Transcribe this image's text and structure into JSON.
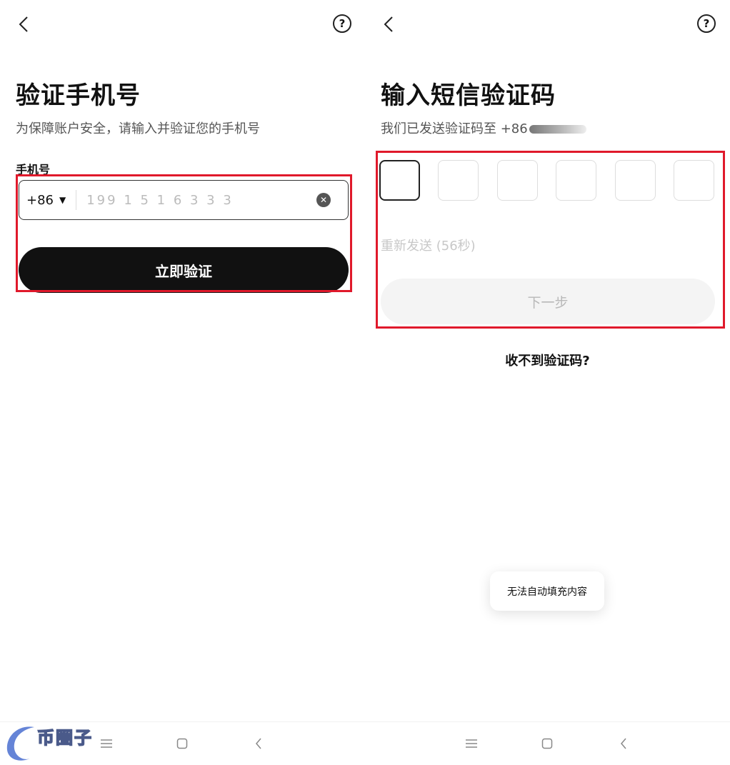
{
  "left": {
    "title": "验证手机号",
    "subtitle": "为保障账户安全，请输入并验证您的手机号",
    "phone_label": "手机号",
    "country_code": "+86",
    "phone_value": "199 1 5 1 6 3 3 3",
    "verify_button": "立即验证",
    "help_icon_glyph": "?"
  },
  "right": {
    "title": "输入短信验证码",
    "subtitle": "我们已发送验证码至 +86",
    "code_cells": [
      "",
      "",
      "",
      "",
      "",
      ""
    ],
    "resend": "重新发送 (56秒)",
    "next_button": "下一步",
    "no_code_link": "收不到验证码?",
    "toast": "无法自动填充内容",
    "help_icon_glyph": "?"
  },
  "watermark": "币圈子",
  "colors": {
    "highlight": "#e0192b",
    "primary_button": "#111111",
    "disabled_button": "#f4f4f4"
  },
  "icons": [
    "back-arrow-icon",
    "help-icon",
    "clear-icon",
    "caret-down-icon",
    "nav-menu-icon",
    "nav-home-icon",
    "nav-back-icon"
  ]
}
